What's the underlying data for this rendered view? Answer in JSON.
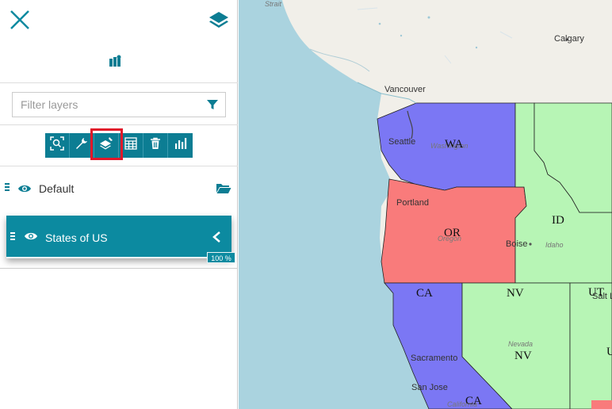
{
  "sidebar": {
    "close_icon": "close-icon",
    "layers_icon": "layers-icon",
    "catalog_icon": "map-catalog-icon",
    "filter": {
      "placeholder": "Filter layers",
      "icon": "filter-icon"
    },
    "toolbar": [
      {
        "name": "zoom-to-layer-button",
        "icon": "zoom-extent-icon"
      },
      {
        "name": "layer-settings-button",
        "icon": "wrench-icon"
      },
      {
        "name": "style-editor-button",
        "icon": "style-brush-icon",
        "highlighted": true
      },
      {
        "name": "attribute-table-button",
        "icon": "table-icon"
      },
      {
        "name": "remove-layer-button",
        "icon": "trash-icon"
      },
      {
        "name": "widget-builder-button",
        "icon": "bar-chart-icon"
      }
    ],
    "group": {
      "label": "Default"
    },
    "layer": {
      "label": "States of US",
      "opacity": "100 %"
    },
    "accent_color": "#0c8aa0",
    "highlight_color": "#e0182a"
  },
  "map": {
    "cities": {
      "calgary": "Calgary",
      "vancouver": "Vancouver",
      "seattle": "Seattle",
      "portland": "Portland",
      "boise": "Boise",
      "sacramento": "Sacramento",
      "san_jose": "San Jose",
      "salt_lake": "Salt Lake City"
    },
    "places": {
      "strait": "Strait",
      "washington": "Washington",
      "oregon": "Oregon",
      "idaho": "Idaho",
      "nevada": "Nevada",
      "california": "California"
    },
    "state_labels": {
      "wa": "WA",
      "or": "OR",
      "id": "ID",
      "nv1": "NV",
      "nv2": "NV",
      "ca1": "CA",
      "ca2": "CA",
      "ut": "UT",
      "ut2": "U"
    },
    "state_colors": {
      "blue": "#7b77f4",
      "red": "#f97b7b",
      "green": "#b7f5b5",
      "ocean": "#aad3df",
      "land": "#f1efe9"
    }
  }
}
